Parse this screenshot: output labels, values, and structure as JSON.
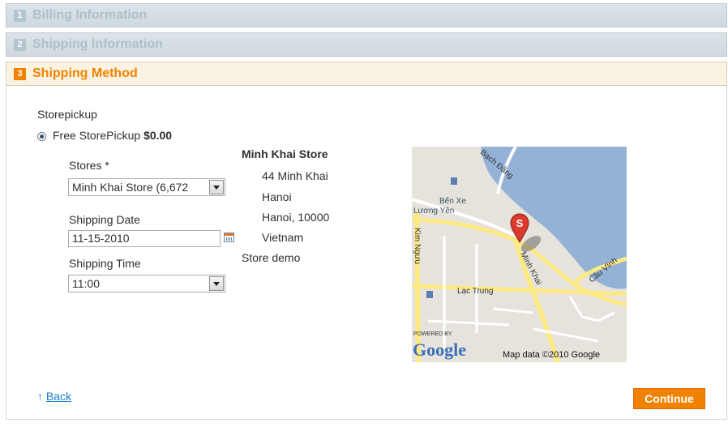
{
  "steps": [
    {
      "num": "1",
      "title": "Billing Information"
    },
    {
      "num": "2",
      "title": "Shipping Information"
    },
    {
      "num": "3",
      "title": "Shipping Method"
    }
  ],
  "method": {
    "group_title": "Storepickup",
    "option_label": "Free StorePickup",
    "option_price": "$0.00",
    "selected": true
  },
  "form": {
    "stores_label": "Stores *",
    "stores_value": "Minh Khai Store (6,672",
    "date_label": "Shipping Date",
    "date_value": "11-15-2010",
    "time_label": "Shipping Time",
    "time_value": "11:00"
  },
  "store": {
    "name": "Minh Khai Store",
    "street": "44 Minh Khai",
    "city": "Hanoi",
    "region_zip": "Hanoi, 10000",
    "country": "Vietnam",
    "description": "Store demo"
  },
  "map": {
    "labels": {
      "road_top": "Bạch Đằng",
      "station_line1": "Bến Xe",
      "station_line2": "Lương Yên",
      "kim_nguu": "Kim Ngưu",
      "minh_khai": "Minh Khai",
      "lac_trung": "Lạc Trung",
      "cau_vinh": "Cầu Vĩnh",
      "powered_by": "POWERED BY",
      "google": "Google",
      "attribution": "Map data ©2010 Google",
      "marker": "S"
    },
    "colors": {
      "water": "#94b1d6",
      "land": "#e6e3dc",
      "road": "#ffffff",
      "major_road": "#fde982",
      "marker": "#d93a2b"
    }
  },
  "nav": {
    "back_label": "Back",
    "continue_label": "Continue"
  },
  "colors": {
    "accent": "#f18200",
    "link": "#1e7ec8"
  },
  "icons": {
    "back": "up-arrow-icon",
    "calendar": "calendar-icon",
    "dropdown": "chevron-down-icon",
    "marker": "map-marker-icon"
  }
}
